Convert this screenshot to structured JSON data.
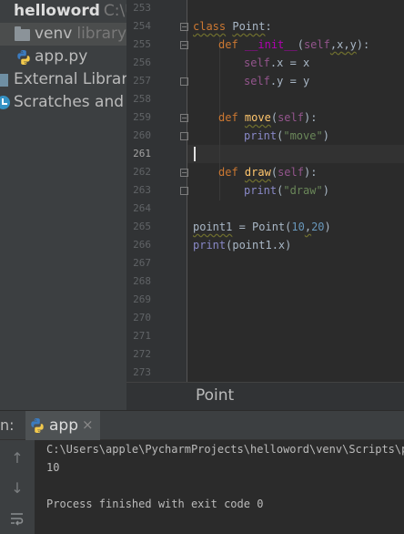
{
  "project_tree": {
    "root_name": "helloword",
    "root_path": "C:\\U",
    "venv_label": "venv",
    "venv_hint": "library r",
    "app_file": "app.py",
    "external_libraries": "External Librarie",
    "scratches": "Scratches and C"
  },
  "editor": {
    "line_numbers": [
      "253",
      "254",
      "255",
      "256",
      "257",
      "258",
      "259",
      "260",
      "261",
      "262",
      "263",
      "264",
      "265",
      "266",
      "267",
      "268",
      "269",
      "270",
      "271",
      "272",
      "273"
    ],
    "current_line": "261"
  },
  "code": {
    "kw_class": "class",
    "class_name": "Point",
    "colon": ":",
    "kw_def": "def",
    "init_name": "__init__",
    "self": "self",
    "param_x": "x",
    "param_y": "y",
    "init_sig_close": "):",
    "assign_x_attr": ".x = x",
    "assign_y_attr": ".y = y",
    "move_name": "move",
    "draw_name": "draw",
    "print": "print",
    "str_move": "\"move\"",
    "str_draw": "\"draw\"",
    "point1_var": "point1",
    "point1_assign": " = Point(",
    "num_10": "10",
    "num_20": "20",
    "close_paren": ")",
    "print_point1_arg": "(point1.x)",
    "open_paren": "(",
    "comma": ","
  },
  "breadcrumb": {
    "label": "Point"
  },
  "run_panel": {
    "label": "n:",
    "tab_label": "app",
    "tab_close": "×",
    "console_lines": [
      "C:\\Users\\apple\\PycharmProjects\\helloword\\venv\\Scripts\\py",
      "10",
      "",
      "Process finished with exit code 0"
    ]
  },
  "colors": {
    "editor_bg": "#2b2b2b",
    "sidebar_bg": "#3c3f41",
    "keyword": "#cc7832",
    "function": "#ffc66d",
    "self_kw": "#94558d",
    "string": "#6a8759",
    "number": "#6897bb"
  },
  "icons": [
    "folder-icon",
    "python-file-icon",
    "library-icon",
    "scratches-icon",
    "python-icon",
    "close-icon",
    "arrow-up-icon",
    "arrow-down-icon",
    "soft-wrap-icon",
    "fold-marker-icon"
  ]
}
